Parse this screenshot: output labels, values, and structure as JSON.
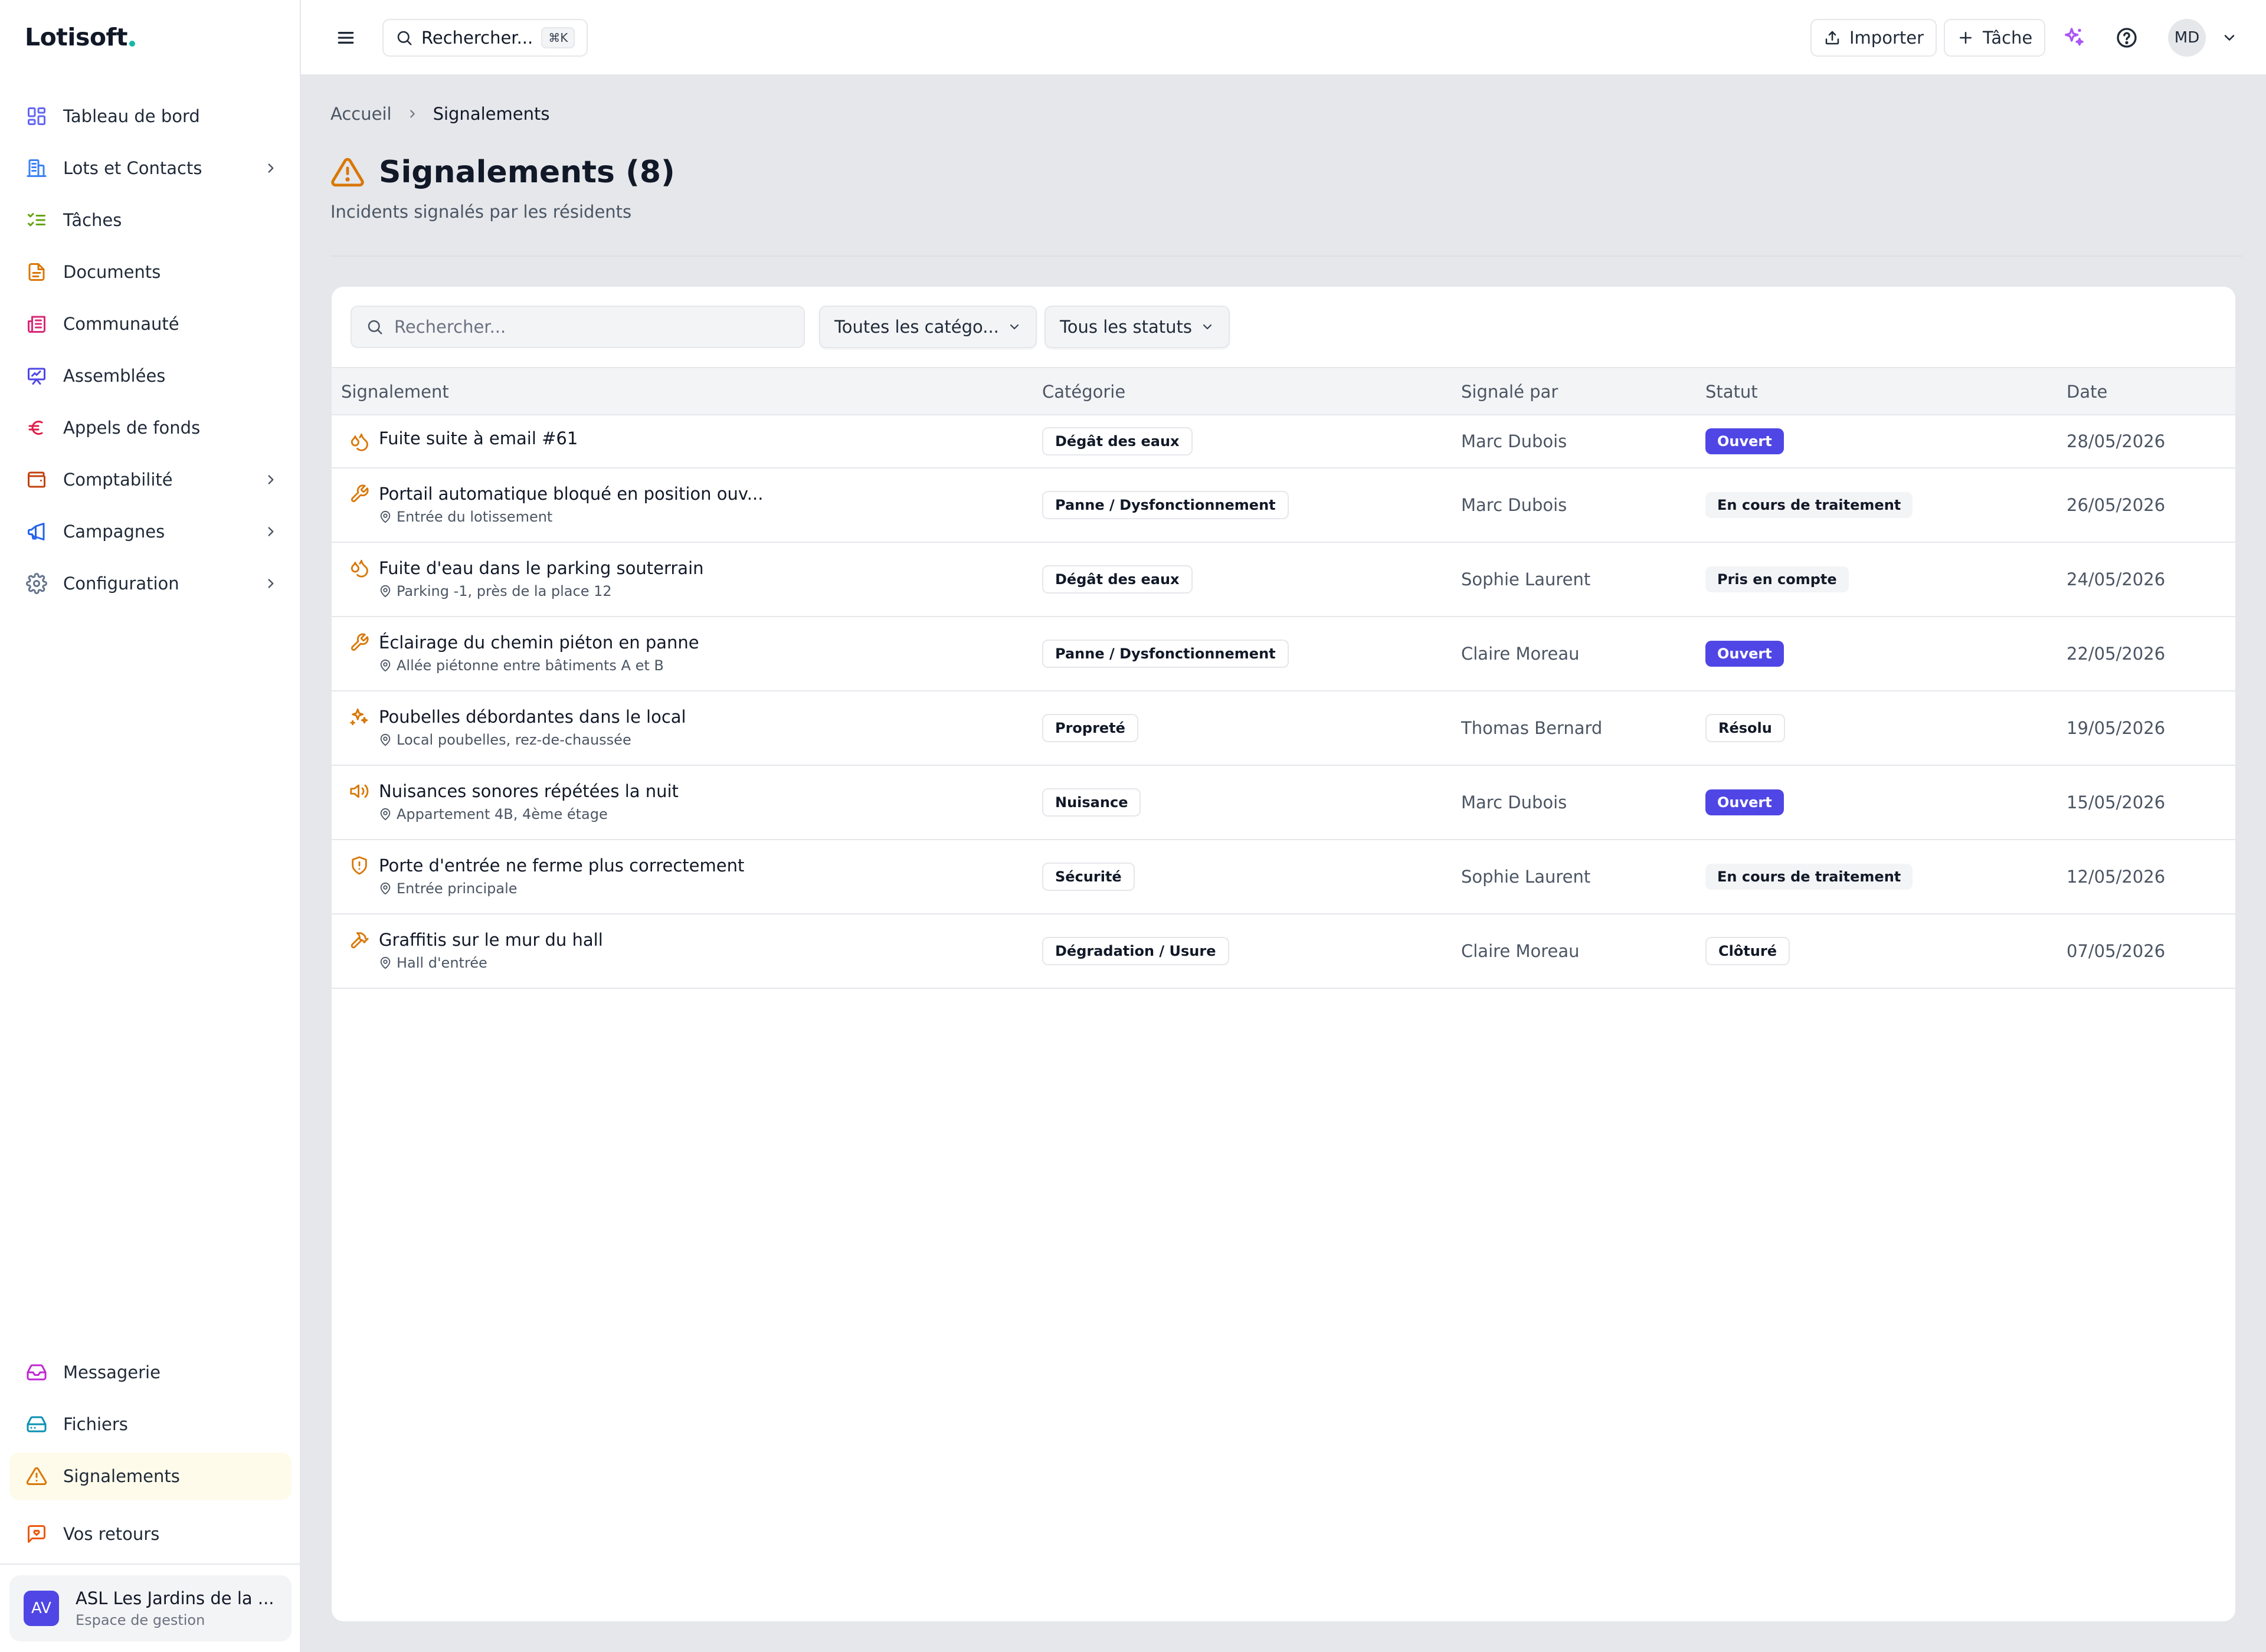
{
  "app": {
    "logo": "Lotisoft"
  },
  "sidebar": {
    "items": [
      {
        "label": "Tableau de bord",
        "icon": "dashboard-icon",
        "color": "#6366f1",
        "chevron": false
      },
      {
        "label": "Lots et Contacts",
        "icon": "building-icon",
        "color": "#3b82f6",
        "chevron": true
      },
      {
        "label": "Tâches",
        "icon": "list-checks-icon",
        "color": "#65a30d",
        "chevron": false
      },
      {
        "label": "Documents",
        "icon": "file-text-icon",
        "color": "#d97706",
        "chevron": false
      },
      {
        "label": "Communauté",
        "icon": "newspaper-icon",
        "color": "#db2777",
        "chevron": false
      },
      {
        "label": "Assemblées",
        "icon": "presentation-icon",
        "color": "#4f46e5",
        "chevron": false
      },
      {
        "label": "Appels de fonds",
        "icon": "euro-icon",
        "color": "#e11d48",
        "chevron": false
      },
      {
        "label": "Comptabilité",
        "icon": "wallet-icon",
        "color": "#c2410c",
        "chevron": true
      },
      {
        "label": "Campagnes",
        "icon": "megaphone-icon",
        "color": "#2563eb",
        "chevron": true
      },
      {
        "label": "Configuration",
        "icon": "settings-icon",
        "color": "#64748b",
        "chevron": true
      }
    ],
    "bottom_items": [
      {
        "label": "Messagerie",
        "icon": "inbox-icon",
        "color": "#c026d3",
        "active": false
      },
      {
        "label": "Fichiers",
        "icon": "hard-drive-icon",
        "color": "#0891b2",
        "active": false
      },
      {
        "label": "Signalements",
        "icon": "alert-triangle-icon",
        "color": "#d97706",
        "active": true
      },
      {
        "label": "Vos retours",
        "icon": "message-heart-icon",
        "color": "#ea580c",
        "active": false
      }
    ],
    "org": {
      "avatar": "AV",
      "name": "ASL Les Jardins de la ...",
      "subtitle": "Espace de gestion"
    }
  },
  "topbar": {
    "search_label": "Rechercher...",
    "search_shortcut": "⌘K",
    "import_label": "Importer",
    "task_label": "Tâche",
    "user_initials": "MD"
  },
  "page": {
    "breadcrumb": {
      "home": "Accueil",
      "current": "Signalements"
    },
    "title": "Signalements (8)",
    "subtitle": "Incidents signalés par les résidents"
  },
  "filters": {
    "search_placeholder": "Rechercher...",
    "category": "Toutes les catégo...",
    "status": "Tous les statuts"
  },
  "table": {
    "columns": [
      "Signalement",
      "Catégorie",
      "Signalé par",
      "Statut",
      "Date"
    ],
    "rows": [
      {
        "icon": "droplets-icon",
        "title": "Fuite suite à email #61",
        "location": "",
        "category": "Dégât des eaux",
        "reporter": "Marc Dubois",
        "status": "Ouvert",
        "status_kind": "ouvert",
        "date": "28/05/2026"
      },
      {
        "icon": "wrench-icon",
        "title": "Portail automatique bloqué en position ouv...",
        "location": "Entrée du lotissement",
        "category": "Panne / Dysfonctionnement",
        "reporter": "Marc Dubois",
        "status": "En cours de traitement",
        "status_kind": "encours",
        "date": "26/05/2026"
      },
      {
        "icon": "droplets-icon",
        "title": "Fuite d'eau dans le parking souterrain",
        "location": "Parking -1, près de la place 12",
        "category": "Dégât des eaux",
        "reporter": "Sophie Laurent",
        "status": "Pris en compte",
        "status_kind": "pris",
        "date": "24/05/2026"
      },
      {
        "icon": "wrench-icon",
        "title": "Éclairage du chemin piéton en panne",
        "location": "Allée piétonne entre bâtiments A et B",
        "category": "Panne / Dysfonctionnement",
        "reporter": "Claire Moreau",
        "status": "Ouvert",
        "status_kind": "ouvert",
        "date": "22/05/2026"
      },
      {
        "icon": "sparkles-icon",
        "title": "Poubelles débordantes dans le local",
        "location": "Local poubelles, rez-de-chaussée",
        "category": "Propreté",
        "reporter": "Thomas Bernard",
        "status": "Résolu",
        "status_kind": "resolu",
        "date": "19/05/2026"
      },
      {
        "icon": "volume-icon",
        "title": "Nuisances sonores répétées la nuit",
        "location": "Appartement 4B, 4ème étage",
        "category": "Nuisance",
        "reporter": "Marc Dubois",
        "status": "Ouvert",
        "status_kind": "ouvert",
        "date": "15/05/2026"
      },
      {
        "icon": "shield-icon",
        "title": "Porte d'entrée ne ferme plus correctement",
        "location": "Entrée principale",
        "category": "Sécurité",
        "reporter": "Sophie Laurent",
        "status": "En cours de traitement",
        "status_kind": "encours",
        "date": "12/05/2026"
      },
      {
        "icon": "hammer-icon",
        "title": "Graffitis sur le mur du hall",
        "location": "Hall d'entrée",
        "category": "Dégradation / Usure",
        "reporter": "Claire Moreau",
        "status": "Clôturé",
        "status_kind": "cloture",
        "date": "07/05/2026"
      }
    ]
  },
  "colors": {
    "accent": "#4f46e5",
    "warning": "#d97706",
    "main_bg": "#e5e7eb"
  }
}
